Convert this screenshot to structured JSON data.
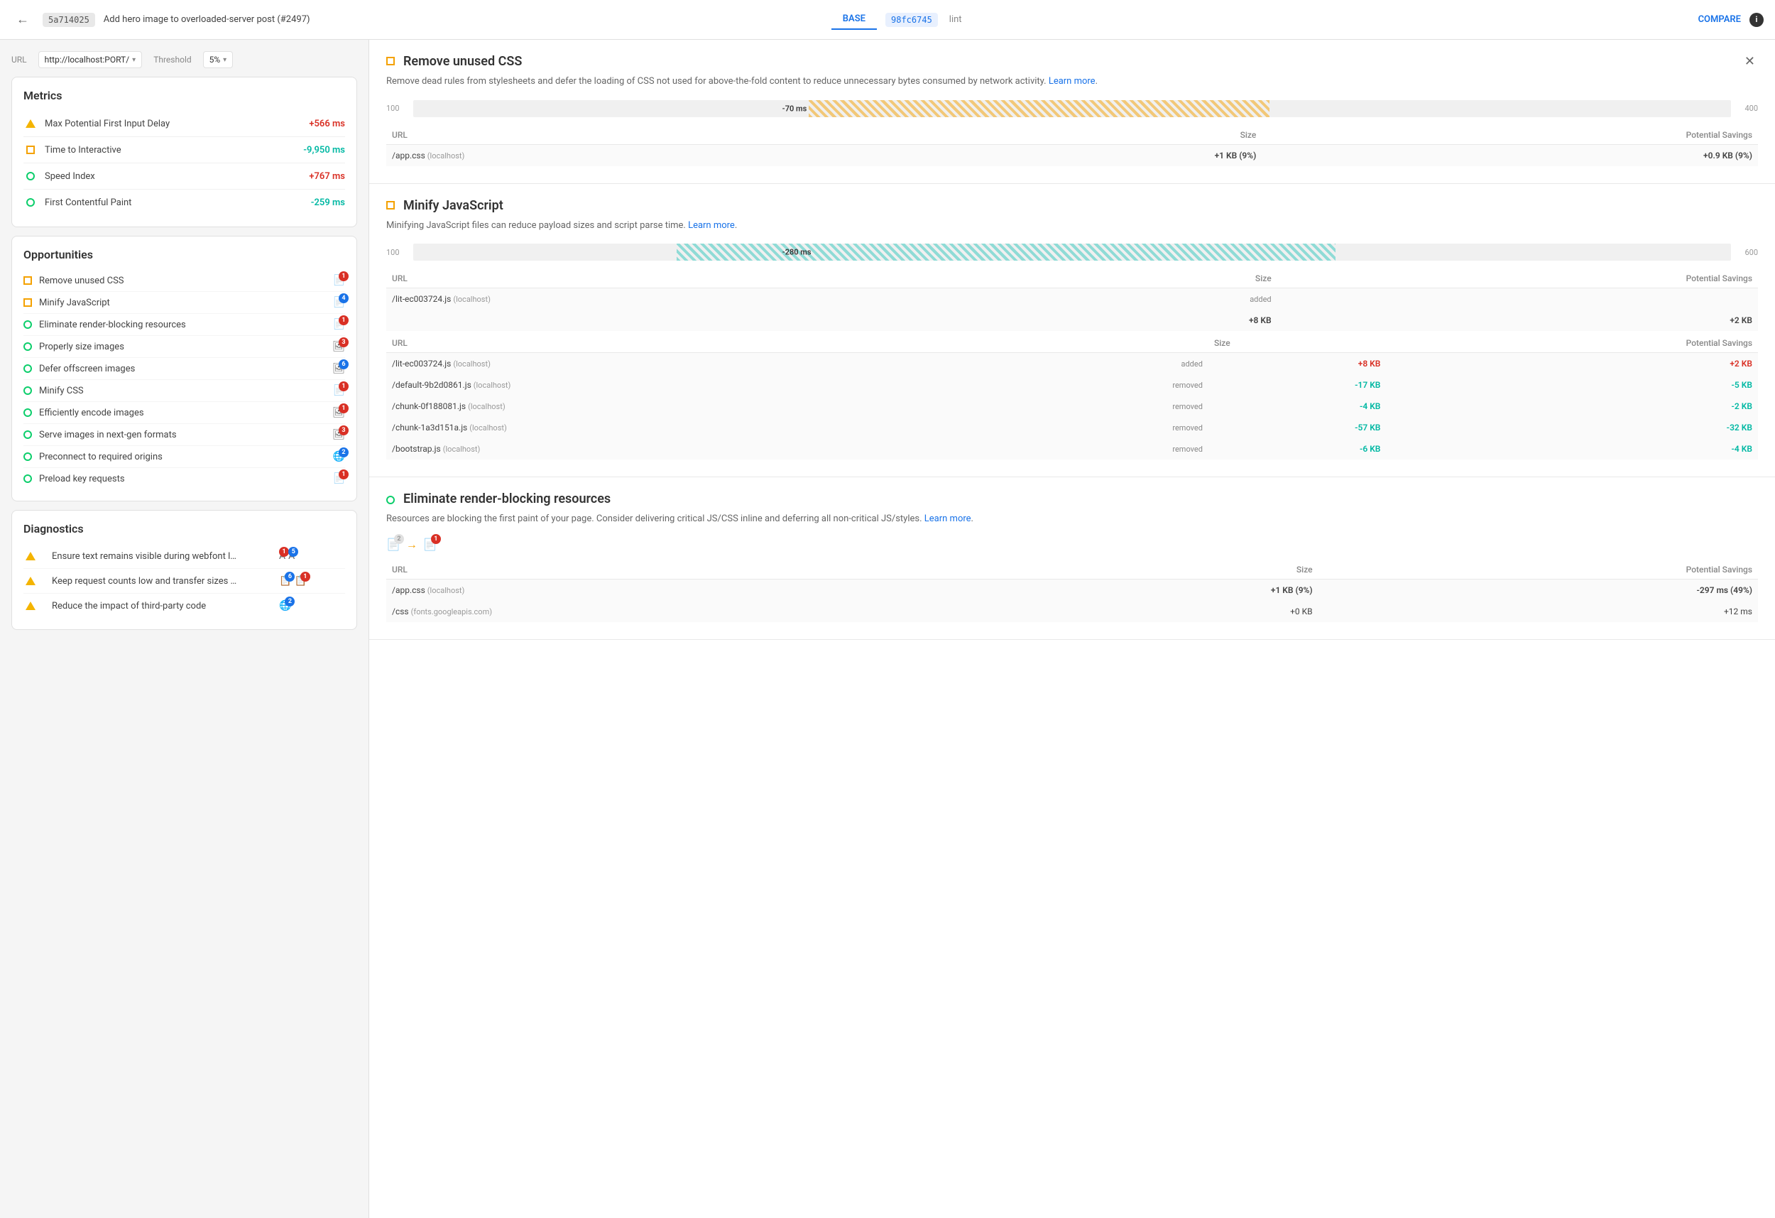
{
  "header": {
    "back_label": "←",
    "commit_hash_base": "5a714025",
    "commit_title": "Add hero image to overloaded-server post (#2497)",
    "tab_base": "BASE",
    "commit_hash_lint": "98fc6745",
    "commit_lint": "lint",
    "compare_label": "COMPARE",
    "info_label": "i"
  },
  "url_bar": {
    "url_label": "URL",
    "url_value": "http://localhost:PORT/",
    "threshold_label": "Threshold",
    "threshold_value": "5%"
  },
  "metrics": {
    "title": "Metrics",
    "items": [
      {
        "icon": "triangle",
        "label": "Max Potential First Input Delay",
        "value": "+566 ms",
        "color": "red"
      },
      {
        "icon": "square-orange",
        "label": "Time to Interactive",
        "value": "-9,950 ms",
        "color": "cyan"
      },
      {
        "icon": "circle-green",
        "label": "Speed Index",
        "value": "+767 ms",
        "color": "red"
      },
      {
        "icon": "circle-green",
        "label": "First Contentful Paint",
        "value": "-259 ms",
        "color": "cyan"
      }
    ]
  },
  "opportunities": {
    "title": "Opportunities",
    "items": [
      {
        "icon": "square-orange",
        "label": "Remove unused CSS",
        "badge": "1",
        "badge_color": "red"
      },
      {
        "icon": "square-orange",
        "label": "Minify JavaScript",
        "badge": "4",
        "badge_color": "blue"
      },
      {
        "icon": "circle-green",
        "label": "Eliminate render-blocking resources",
        "badge": "1",
        "badge_color": "red"
      },
      {
        "icon": "circle-green",
        "label": "Properly size images",
        "badge": "3",
        "badge_color": "red"
      },
      {
        "icon": "circle-green",
        "label": "Defer offscreen images",
        "badge": "6",
        "badge_color": "blue"
      },
      {
        "icon": "circle-green",
        "label": "Minify CSS",
        "badge": "1",
        "badge_color": "red"
      },
      {
        "icon": "circle-green",
        "label": "Efficiently encode images",
        "badge": "1",
        "badge_color": "red"
      },
      {
        "icon": "circle-green",
        "label": "Serve images in next-gen formats",
        "badge": "3",
        "badge_color": "red"
      },
      {
        "icon": "circle-green",
        "label": "Preconnect to required origins",
        "badge": "2",
        "badge_color": "blue"
      },
      {
        "icon": "circle-green",
        "label": "Preload key requests",
        "badge": "1",
        "badge_color": "red"
      }
    ]
  },
  "diagnostics": {
    "title": "Diagnostics",
    "items": [
      {
        "icon": "triangle",
        "label": "Ensure text remains visible during webfont l…",
        "badge1": "1",
        "badge2": "5",
        "badge2_color": "blue"
      },
      {
        "icon": "triangle",
        "label": "Keep request counts low and transfer sizes …",
        "badge1": "6",
        "badge2": "1",
        "badge2_color": "red"
      },
      {
        "icon": "triangle",
        "label": "Reduce the impact of third-party code",
        "badge": "2",
        "badge_color": "blue"
      }
    ]
  },
  "right_panel": {
    "sections": [
      {
        "id": "remove-unused-css",
        "icon": "square-orange",
        "title": "Remove unused CSS",
        "description": "Remove dead rules from stylesheets and defer the loading of CSS not used for above-the-fold content to reduce unnecessary bytes consumed by network activity.",
        "learn_more": "Learn more",
        "timeline": {
          "left_label": "100",
          "right_label": "400",
          "value_label": "-70 ms",
          "fill_start_pct": 40,
          "fill_width_pct": 35,
          "fill_type": "orange"
        },
        "table": {
          "headers": [
            "URL",
            "Size",
            "Potential Savings"
          ],
          "rows": [
            {
              "url": "/app.css",
              "host": "localhost",
              "status": "",
              "size": "+1 KB (9%)",
              "size_color": "red",
              "savings": "+0.9 KB (9%)",
              "savings_color": "red"
            }
          ]
        }
      },
      {
        "id": "minify-javascript",
        "icon": "square-orange",
        "title": "Minify JavaScript",
        "description": "Minifying JavaScript files can reduce payload sizes and script parse time.",
        "learn_more": "Learn more",
        "timeline": {
          "left_label": "100",
          "right_label": "600",
          "value_label": "-280 ms",
          "fill_start_pct": 30,
          "fill_width_pct": 45,
          "fill_type": "cyan"
        },
        "table": {
          "headers": [
            "URL",
            "Size",
            "Potential Savings"
          ],
          "rows": [
            {
              "url": "/lit-ec003724.js",
              "host": "localhost",
              "status": "added",
              "size": "+8 KB",
              "size_color": "red",
              "savings": "+2 KB",
              "savings_color": "red"
            },
            {
              "url": "/default-9b2d0861.js",
              "host": "localhost",
              "status": "removed",
              "size": "-17 KB",
              "size_color": "cyan",
              "savings": "-5 KB",
              "savings_color": "cyan"
            },
            {
              "url": "/chunk-0f188081.js",
              "host": "localhost",
              "status": "removed",
              "size": "-4 KB",
              "size_color": "cyan",
              "savings": "-2 KB",
              "savings_color": "cyan"
            },
            {
              "url": "/chunk-1a3d151a.js",
              "host": "localhost",
              "status": "removed",
              "size": "-57 KB",
              "size_color": "cyan",
              "savings": "-32 KB",
              "savings_color": "cyan"
            },
            {
              "url": "/bootstrap.js",
              "host": "localhost",
              "status": "removed",
              "size": "-6 KB",
              "size_color": "cyan",
              "savings": "-4 KB",
              "savings_color": "cyan"
            }
          ]
        }
      },
      {
        "id": "eliminate-render-blocking",
        "icon": "circle-green",
        "title": "Eliminate render-blocking resources",
        "description": "Resources are blocking the first paint of your page. Consider delivering critical JS/CSS inline and deferring all non-critical JS/styles.",
        "learn_more": "Learn more",
        "timeline": null,
        "table": {
          "headers": [
            "URL",
            "Size",
            "Potential Savings"
          ],
          "rows": [
            {
              "url": "/app.css",
              "host": "localhost",
              "status": "",
              "size": "+1 KB (9%)",
              "size_color": "red",
              "savings": "-297 ms (49%)",
              "savings_color": "cyan"
            },
            {
              "url": "/css",
              "host": "fonts.googleapis.com",
              "status": "",
              "size": "+0 KB",
              "size_color": "neutral",
              "savings": "+12 ms",
              "savings_color": "neutral"
            }
          ]
        }
      }
    ]
  }
}
